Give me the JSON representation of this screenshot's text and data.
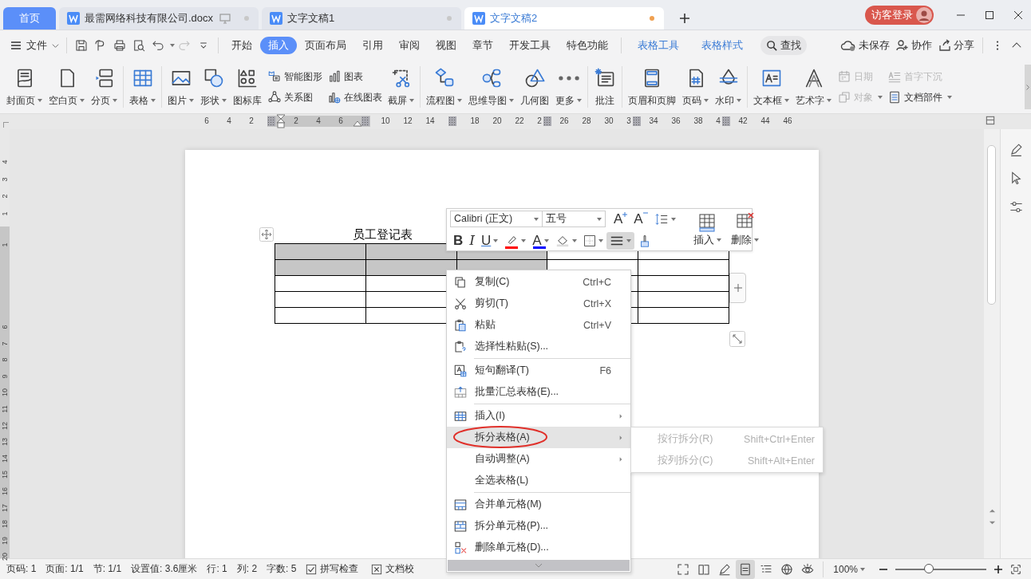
{
  "home_tab": "首页",
  "tabs": [
    {
      "label": "最需网络科技有限公司.docx",
      "selected": false,
      "unsaved": false,
      "remote": true
    },
    {
      "label": "文字文稿1",
      "selected": false,
      "unsaved": false,
      "remote": false
    },
    {
      "label": "文字文稿2",
      "selected": true,
      "unsaved": true,
      "remote": false
    }
  ],
  "login": "访客登录",
  "file_menu": "文件",
  "menu_tabs": [
    {
      "label": "开始",
      "selected": false,
      "kind": "main"
    },
    {
      "label": "插入",
      "selected": true,
      "kind": "main"
    },
    {
      "label": "页面布局",
      "selected": false,
      "kind": "main"
    },
    {
      "label": "引用",
      "selected": false,
      "kind": "main"
    },
    {
      "label": "审阅",
      "selected": false,
      "kind": "main"
    },
    {
      "label": "视图",
      "selected": false,
      "kind": "main"
    },
    {
      "label": "章节",
      "selected": false,
      "kind": "main"
    },
    {
      "label": "开发工具",
      "selected": false,
      "kind": "main"
    },
    {
      "label": "特色功能",
      "selected": false,
      "kind": "main"
    },
    {
      "label": "表格工具",
      "selected": false,
      "kind": "context"
    },
    {
      "label": "表格样式",
      "selected": false,
      "kind": "context"
    }
  ],
  "search": "查找",
  "actions": [
    "未保存",
    "协作",
    "分享"
  ],
  "ribbon": [
    [
      {
        "kind": "large",
        "label": "封面页",
        "dropdown": true
      },
      {
        "kind": "large",
        "label": "空白页",
        "dropdown": true
      },
      {
        "kind": "large",
        "label": "分页",
        "dropdown": true
      }
    ],
    [
      {
        "kind": "large",
        "label": "表格",
        "dropdown": true
      }
    ],
    [
      {
        "kind": "large",
        "label": "图片",
        "dropdown": true
      },
      {
        "kind": "large",
        "label": "形状",
        "dropdown": true
      },
      {
        "kind": "large",
        "label": "图标库",
        "dropdown": false
      },
      {
        "kind": "stack",
        "rows": [
          {
            "label": "智能图形",
            "dropdown": false,
            "disabled": false
          },
          {
            "label": "关系图",
            "dropdown": false,
            "disabled": false
          }
        ]
      },
      {
        "kind": "stack",
        "rows": [
          {
            "label": "图表",
            "dropdown": false,
            "disabled": false
          },
          {
            "label": "在线图表",
            "dropdown": false,
            "disabled": false
          }
        ]
      },
      {
        "kind": "large",
        "label": "截屏",
        "dropdown": true
      }
    ],
    [
      {
        "kind": "large",
        "label": "流程图",
        "dropdown": true
      },
      {
        "kind": "large",
        "label": "思维导图",
        "dropdown": true
      },
      {
        "kind": "large",
        "label": "几何图",
        "dropdown": false
      },
      {
        "kind": "large",
        "label": "更多",
        "dropdown": true
      }
    ],
    [
      {
        "kind": "large",
        "label": "批注",
        "dropdown": false
      }
    ],
    [
      {
        "kind": "large",
        "label": "页眉和页脚",
        "dropdown": false
      },
      {
        "kind": "large",
        "label": "页码",
        "dropdown": true
      },
      {
        "kind": "large",
        "label": "水印",
        "dropdown": true
      }
    ],
    [
      {
        "kind": "large",
        "label": "文本框",
        "dropdown": true
      },
      {
        "kind": "large",
        "label": "艺术字",
        "dropdown": true
      },
      {
        "kind": "stack",
        "rows": [
          {
            "label": "日期",
            "dropdown": false,
            "disabled": true
          },
          {
            "label": "对象",
            "dropdown": true,
            "disabled": true
          }
        ]
      },
      {
        "kind": "stack",
        "rows": [
          {
            "label": "首字下沉",
            "dropdown": false,
            "disabled": true
          },
          {
            "label": "文档部件",
            "dropdown": true,
            "disabled": false
          }
        ]
      }
    ]
  ],
  "ruler": [
    "6",
    "4",
    "2",
    "2",
    "4",
    "6",
    "10",
    "12",
    "14",
    "18",
    "20",
    "22",
    "2",
    "26",
    "28",
    "30",
    "3",
    "34",
    "36",
    "38",
    "4",
    "42",
    "44",
    "46"
  ],
  "vertical_ruler": [
    "4",
    "3",
    "2",
    "1",
    "1",
    "6",
    "7",
    "8",
    "9",
    "10",
    "11",
    "12",
    "13",
    "14",
    "15",
    "16",
    "17",
    "18",
    "19",
    "20"
  ],
  "table_title": "员工登记表",
  "table_rows": [
    {
      "cells": [
        {
          "selected": true
        },
        {
          "selected": true
        },
        {
          "selected": true
        },
        {
          "selected": false
        },
        {
          "selected": false
        }
      ]
    },
    {
      "cells": [
        {
          "selected": true
        },
        {
          "selected": true
        },
        {
          "selected": true
        },
        {
          "selected": false
        },
        {
          "selected": false
        }
      ]
    },
    {
      "cells": [
        {
          "selected": false
        },
        {
          "selected": false
        },
        {
          "selected": false
        },
        {
          "selected": false
        }
      ]
    },
    {
      "cells": [
        {
          "selected": false
        },
        {
          "selected": false
        },
        {
          "selected": false
        },
        {
          "selected": false
        }
      ]
    },
    {
      "cells": [
        {
          "selected": false
        },
        {
          "selected": false
        },
        {
          "selected": false
        },
        {
          "selected": false
        }
      ]
    }
  ],
  "mini_toolbar": {
    "font": "Calibri (正文)",
    "size": "五号",
    "buttons": [
      {
        "kind": "grow",
        "label": "A",
        "dropdown": false,
        "selected": false
      },
      {
        "kind": "shrink",
        "label": "A",
        "dropdown": false,
        "selected": false
      },
      {
        "kind": "spacing",
        "dropdown": true,
        "selected": false
      },
      {
        "kind": "bold",
        "label": "B",
        "dropdown": false,
        "selected": false
      },
      {
        "kind": "italic",
        "label": "I",
        "dropdown": false,
        "selected": false
      },
      {
        "kind": "underline",
        "label": "U",
        "dropdown": true,
        "selected": false
      },
      {
        "kind": "highlight",
        "color": "#ff0000",
        "dropdown": true,
        "selected": false
      },
      {
        "kind": "font_color",
        "label": "A",
        "color": "#0000ff",
        "dropdown": true,
        "selected": false
      },
      {
        "kind": "shading",
        "dropdown": true,
        "selected": false
      },
      {
        "kind": "borders",
        "dropdown": true,
        "selected": false
      },
      {
        "kind": "align",
        "dropdown": true,
        "selected": true
      },
      {
        "kind": "painter",
        "dropdown": false,
        "selected": false
      }
    ],
    "table_buttons": [
      {
        "kind": "insert",
        "label": "插入"
      },
      {
        "kind": "delete",
        "label": "删除"
      }
    ]
  },
  "context_menu": [
    {
      "label": "复制(C)",
      "shortcut": "Ctrl+C",
      "submenu": false,
      "selected": false,
      "separator_before": false
    },
    {
      "label": "剪切(T)",
      "shortcut": "Ctrl+X",
      "submenu": false,
      "selected": false,
      "separator_before": false
    },
    {
      "label": "粘贴",
      "shortcut": "Ctrl+V",
      "submenu": false,
      "selected": false,
      "separator_before": false
    },
    {
      "label": "选择性粘贴(S)...",
      "submenu": false,
      "selected": false,
      "separator_before": false
    },
    {
      "label": "短句翻译(T)",
      "shortcut": "F6",
      "submenu": false,
      "selected": false,
      "separator_before": true
    },
    {
      "label": "批量汇总表格(E)...",
      "submenu": false,
      "selected": false,
      "separator_before": false
    },
    {
      "label": "插入(I)",
      "submenu": true,
      "selected": false,
      "separator_before": true
    },
    {
      "label": "拆分表格(A)",
      "submenu": true,
      "selected": true,
      "separator_before": false
    },
    {
      "label": "自动调整(A)",
      "submenu": true,
      "selected": false,
      "separator_before": false
    },
    {
      "label": "全选表格(L)",
      "submenu": false,
      "selected": false,
      "separator_before": false
    },
    {
      "label": "合并单元格(M)",
      "submenu": false,
      "selected": false,
      "separator_before": true
    },
    {
      "label": "拆分单元格(P)...",
      "submenu": false,
      "selected": false,
      "separator_before": false
    },
    {
      "label": "删除单元格(D)...",
      "submenu": false,
      "selected": false,
      "separator_before": false
    }
  ],
  "submenu": [
    {
      "label": "按行拆分(R)",
      "shortcut": "Shift+Ctrl+Enter",
      "disabled": true
    },
    {
      "label": "按列拆分(C)",
      "shortcut": "Shift+Alt+Enter",
      "disabled": true
    }
  ],
  "status_bar": [
    {
      "kind": "text",
      "label": "页码: 1"
    },
    {
      "kind": "text",
      "label": "页面: 1/1"
    },
    {
      "kind": "text",
      "label": "节: 1/1"
    },
    {
      "kind": "text",
      "label": "设置值: 3.6厘米"
    },
    {
      "kind": "text",
      "label": "行: 1"
    },
    {
      "kind": "text",
      "label": "列: 2"
    },
    {
      "kind": "text",
      "label": "字数: 5"
    },
    {
      "kind": "tool",
      "label": "拼写检查"
    },
    {
      "kind": "tool",
      "label": "文档校"
    }
  ],
  "views": [
    {
      "selected": false
    },
    {
      "selected": false
    },
    {
      "selected": false
    },
    {
      "selected": true
    },
    {
      "selected": false
    },
    {
      "selected": false
    },
    {
      "selected": false
    }
  ],
  "zoom": {
    "value": "100%",
    "level": 0.37
  }
}
